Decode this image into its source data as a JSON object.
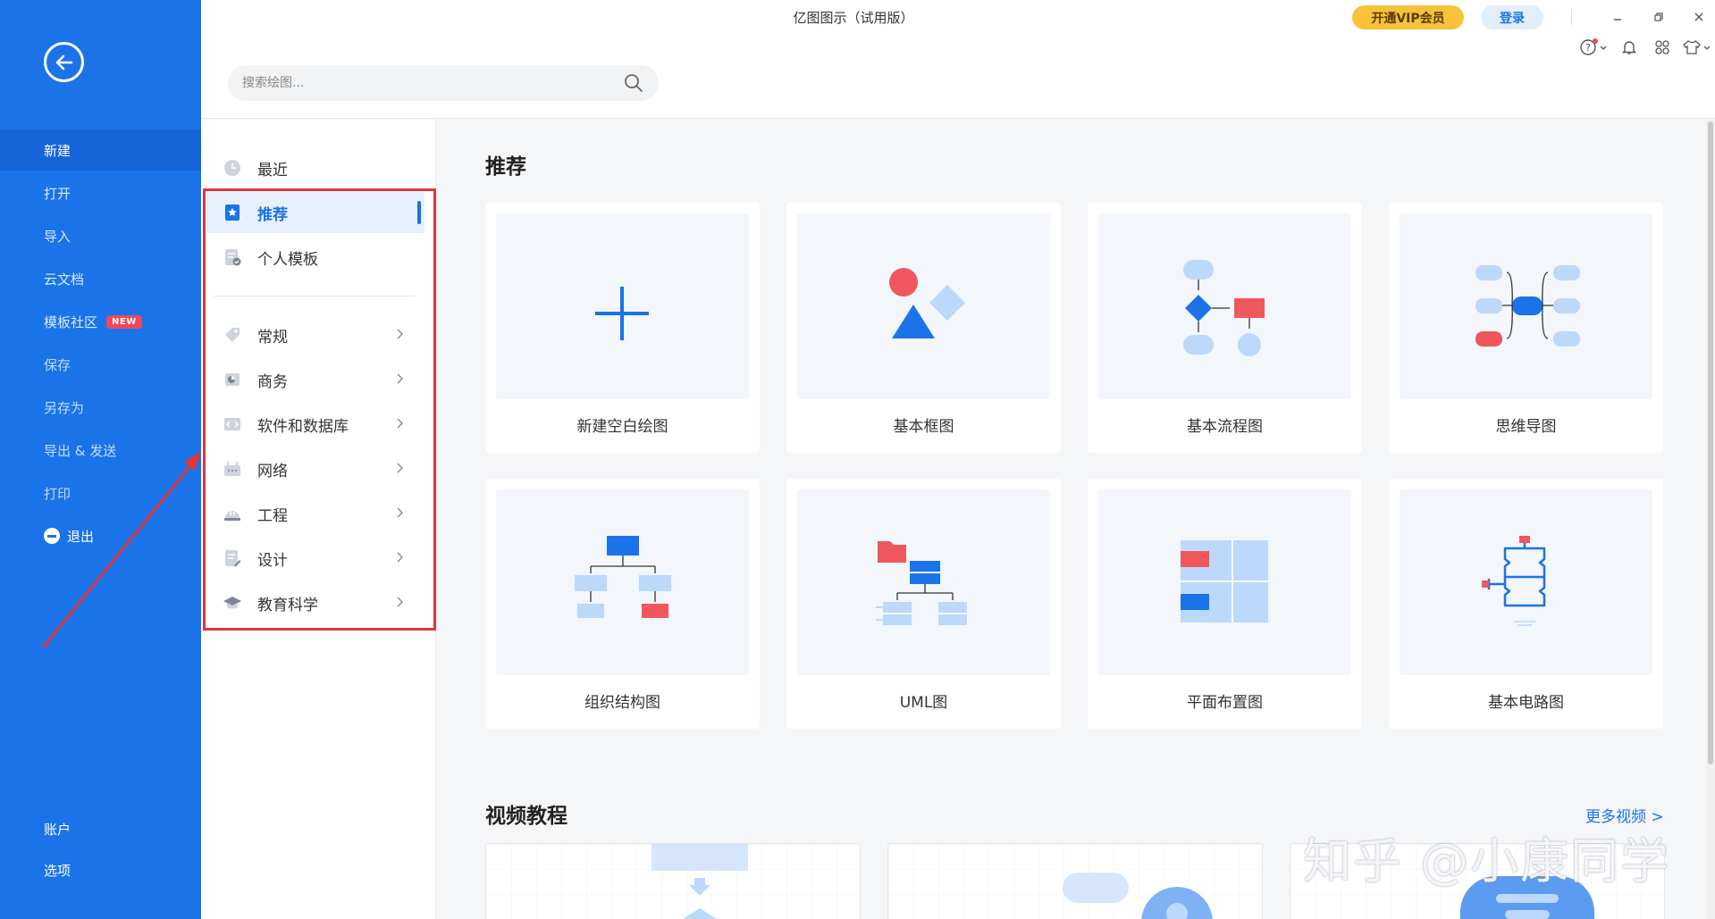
{
  "app": {
    "title": "亿图图示（试用版）"
  },
  "header": {
    "vip_label": "开通VIP会员",
    "login_label": "登录",
    "search_placeholder": "搜索绘图..."
  },
  "sidebar": {
    "items": [
      {
        "label": "新建"
      },
      {
        "label": "打开"
      },
      {
        "label": "导入"
      },
      {
        "label": "云文档"
      },
      {
        "label": "模板社区",
        "badge": "NEW"
      },
      {
        "label": "保存"
      },
      {
        "label": "另存为"
      },
      {
        "label": "导出 & 发送"
      },
      {
        "label": "打印"
      },
      {
        "label": "退出"
      }
    ],
    "bottom_items": [
      {
        "label": "账户"
      },
      {
        "label": "选项"
      }
    ]
  },
  "categories": {
    "top": [
      {
        "label": "最近",
        "icon": "clock-icon"
      },
      {
        "label": "推荐",
        "icon": "star-icon"
      },
      {
        "label": "个人模板",
        "icon": "personal-template-icon"
      }
    ],
    "groups": [
      {
        "label": "常规",
        "icon": "tag-icon"
      },
      {
        "label": "商务",
        "icon": "business-icon"
      },
      {
        "label": "软件和数据库",
        "icon": "code-icon"
      },
      {
        "label": "网络",
        "icon": "network-icon"
      },
      {
        "label": "工程",
        "icon": "helmet-icon"
      },
      {
        "label": "设计",
        "icon": "design-icon"
      },
      {
        "label": "教育科学",
        "icon": "graduation-cap-icon"
      }
    ]
  },
  "main": {
    "recommend_title": "推荐",
    "templates": [
      {
        "label": "新建空白绘图",
        "icon": "plus-icon"
      },
      {
        "label": "基本框图",
        "icon": "basic-shapes-icon"
      },
      {
        "label": "基本流程图",
        "icon": "flowchart-icon"
      },
      {
        "label": "思维导图",
        "icon": "mindmap-icon"
      },
      {
        "label": "组织结构图",
        "icon": "org-chart-icon"
      },
      {
        "label": "UML图",
        "icon": "uml-icon"
      },
      {
        "label": "平面布置图",
        "icon": "floor-plan-icon"
      },
      {
        "label": "基本电路图",
        "icon": "circuit-icon"
      }
    ],
    "video_title": "视频教程",
    "more_videos": "更多视频 >"
  },
  "watermark": "知乎 @小康同学",
  "colors": {
    "brand_blue": "#1a73e8",
    "accent_red": "#f0575c",
    "light_blue": "#bcd8fb",
    "vip_gold": "#f7c23a",
    "highlight_red": "#e0353b"
  }
}
